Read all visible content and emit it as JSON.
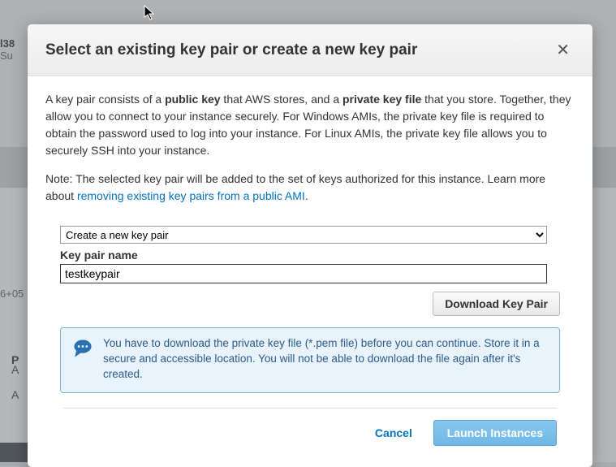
{
  "background": {
    "truncated_id": "l38",
    "truncated_sub": "Su",
    "ts_fragment": "6+05",
    "p": "P",
    "a1": "A",
    "a2": "A"
  },
  "modal": {
    "title": "Select an existing key pair or create a new key pair",
    "close": "✕",
    "desc_1a": "A key pair consists of a ",
    "desc_1_public": "public key",
    "desc_1b": " that AWS stores, and a ",
    "desc_1_private": "private key file",
    "desc_1c": " that you store. Together, they allow you to connect to your instance securely. For Windows AMIs, the private key file is required to obtain the password used to log into your instance. For Linux AMIs, the private key file allows you to securely SSH into your instance.",
    "desc_2a": "Note: The selected key pair will be added to the set of keys authorized for this instance. Learn more about ",
    "desc_2_link": "removing existing key pairs from a public AMI",
    "desc_2b": ".",
    "select_option": "Create a new key pair",
    "keyname_label": "Key pair name",
    "keyname_value": "testkeypair",
    "download_label": "Download Key Pair",
    "info_1a": "You have to download the ",
    "info_1_bold1": "private key file",
    "info_1b": " (*.pem file) before you can continue. ",
    "info_1_bold2": "Store it in a secure and accessible location.",
    "info_1c": " You will not be able to download the file again after it's created.",
    "cancel": "Cancel",
    "launch": "Launch Instances"
  }
}
